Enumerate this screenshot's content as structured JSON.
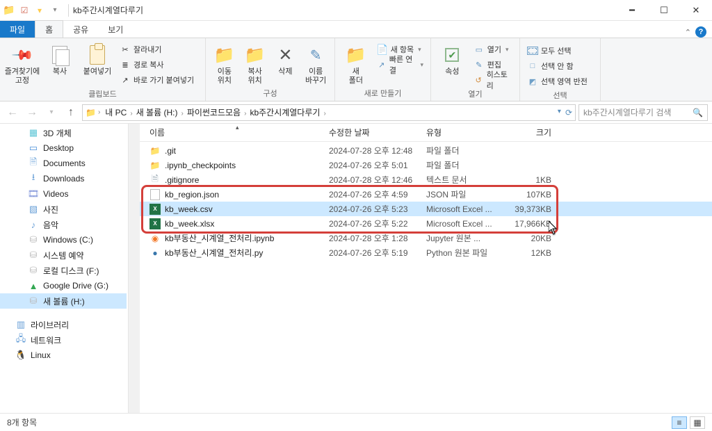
{
  "titlebar": {
    "title": "kb주간시계열다루기"
  },
  "tabs": {
    "file": "파일",
    "home": "홈",
    "share": "공유",
    "view": "보기"
  },
  "ribbon": {
    "group_clipboard": "클립보드",
    "group_organize": "구성",
    "group_new": "새로 만들기",
    "group_open": "열기",
    "group_select": "선택",
    "pin": "즐겨찾기에\n고정",
    "copy": "복사",
    "paste": "붙여넣기",
    "cut": "잘라내기",
    "copy_path": "경로 복사",
    "paste_shortcut": "바로 가기 붙여넣기",
    "move_to": "이동\n위치",
    "copy_to": "복사\n위치",
    "delete": "삭제",
    "rename": "이름\n바꾸기",
    "new_folder": "새\n폴더",
    "new_item": "새 항목",
    "easy_access": "빠른 연결",
    "properties": "속성",
    "open": "열기",
    "edit": "편집",
    "history": "히스토리",
    "select_all": "모두 선택",
    "select_none": "선택 안 함",
    "invert_selection": "선택 영역 반전"
  },
  "breadcrumbs": [
    "내 PC",
    "새 볼륨 (H:)",
    "파이썬코드모음",
    "kb주간시계열다루기"
  ],
  "search_placeholder": "kb주간시계열다루기 검색",
  "sidebar": [
    {
      "label": "3D 개체",
      "cls": "s-3d",
      "glyph": "▦"
    },
    {
      "label": "Desktop",
      "cls": "s-desk",
      "glyph": "▭"
    },
    {
      "label": "Documents",
      "cls": "s-doc",
      "glyph": "🗎"
    },
    {
      "label": "Downloads",
      "cls": "s-dl",
      "glyph": "⭳"
    },
    {
      "label": "Videos",
      "cls": "s-vid",
      "glyph": "🎞"
    },
    {
      "label": "사진",
      "cls": "s-pic",
      "glyph": "▧"
    },
    {
      "label": "음악",
      "cls": "s-mus",
      "glyph": "♪"
    },
    {
      "label": "Windows (C:)",
      "cls": "s-drive",
      "glyph": "⛁"
    },
    {
      "label": "시스템 예약",
      "cls": "s-drive",
      "glyph": "⛁"
    },
    {
      "label": "로컬 디스크 (F:)",
      "cls": "s-drive",
      "glyph": "⛁"
    },
    {
      "label": "Google Drive (G:)",
      "cls": "s-gd",
      "glyph": "▲"
    },
    {
      "label": "새 볼륨 (H:)",
      "cls": "s-drive",
      "glyph": "⛁",
      "selected": true
    }
  ],
  "sidebar_extra": [
    {
      "label": "라이브러리",
      "cls": "s-lib",
      "glyph": "▥"
    },
    {
      "label": "네트워크",
      "cls": "s-net",
      "glyph": "🖧"
    },
    {
      "label": "Linux",
      "cls": "s-tux",
      "glyph": "🐧"
    }
  ],
  "columns": {
    "name": "이름",
    "date": "수정한 날짜",
    "type": "유형",
    "size": "크기"
  },
  "files": [
    {
      "name": ".git",
      "date": "2024-07-28 오후 12:48",
      "type": "파일 폴더",
      "size": "",
      "icon": "folder"
    },
    {
      "name": ".ipynb_checkpoints",
      "date": "2024-07-26 오후 5:01",
      "type": "파일 폴더",
      "size": "",
      "icon": "folder"
    },
    {
      "name": ".gitignore",
      "date": "2024-07-28 오후 12:46",
      "type": "텍스트 문서",
      "size": "1KB",
      "icon": "text"
    },
    {
      "name": "kb_region.json",
      "date": "2024-07-26 오후 4:59",
      "type": "JSON 파일",
      "size": "107KB",
      "icon": "json"
    },
    {
      "name": "kb_week.csv",
      "date": "2024-07-26 오후 5:23",
      "type": "Microsoft Excel ...",
      "size": "39,373KB",
      "icon": "xls",
      "selected": true
    },
    {
      "name": "kb_week.xlsx",
      "date": "2024-07-26 오후 5:22",
      "type": "Microsoft Excel ...",
      "size": "17,966KB",
      "icon": "xls"
    },
    {
      "name": "kb부동산_시계열_전처리.ipynb",
      "date": "2024-07-28 오후 1:28",
      "type": "Jupyter 원본 ...",
      "size": "20KB",
      "icon": "ipynb"
    },
    {
      "name": "kb부동산_시계열_전처리.py",
      "date": "2024-07-26 오후 5:19",
      "type": "Python 원본 파일",
      "size": "12KB",
      "icon": "py"
    }
  ],
  "status": "8개 항목"
}
